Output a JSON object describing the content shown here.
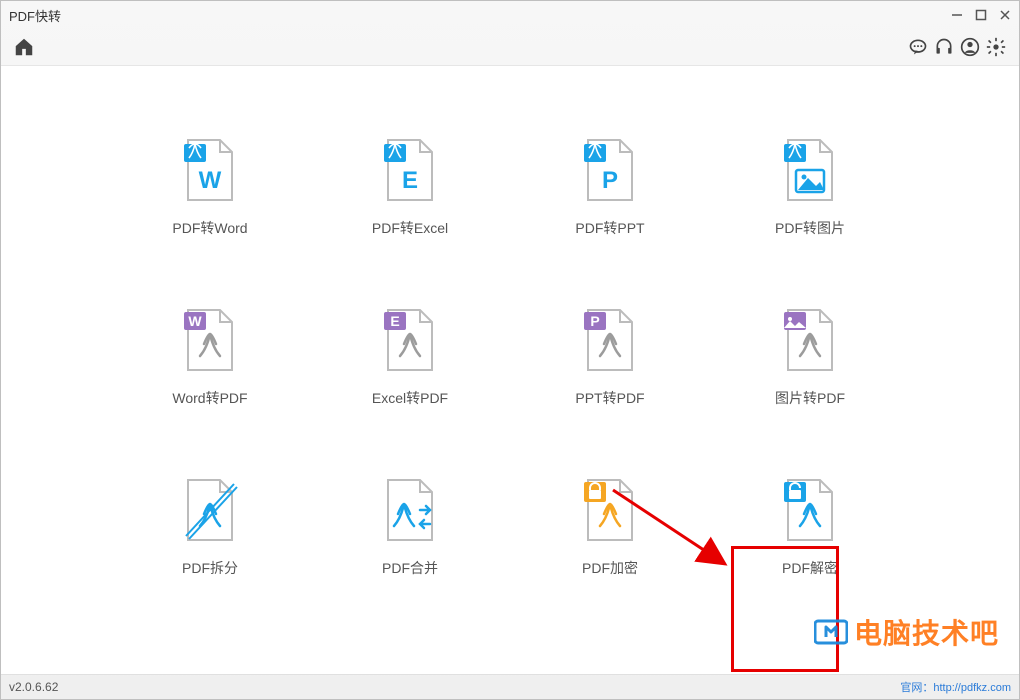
{
  "window": {
    "title": "PDF快转"
  },
  "status": {
    "version": "v2.0.6.62",
    "site_label": "官网：http://pdfkz.com"
  },
  "watermark": {
    "text": "电脑技术吧"
  },
  "colors": {
    "blue": "#1aa3e8",
    "purple": "#9a74c1",
    "orange": "#f5a623",
    "gray": "#9c9c9c",
    "red": "#e60000"
  },
  "tiles": [
    {
      "id": "pdf-to-word",
      "label": "PDF转Word"
    },
    {
      "id": "pdf-to-excel",
      "label": "PDF转Excel"
    },
    {
      "id": "pdf-to-ppt",
      "label": "PDF转PPT"
    },
    {
      "id": "pdf-to-image",
      "label": "PDF转图片"
    },
    {
      "id": "word-to-pdf",
      "label": "Word转PDF"
    },
    {
      "id": "excel-to-pdf",
      "label": "Excel转PDF"
    },
    {
      "id": "ppt-to-pdf",
      "label": "PPT转PDF"
    },
    {
      "id": "image-to-pdf",
      "label": "图片转PDF"
    },
    {
      "id": "pdf-split",
      "label": "PDF拆分"
    },
    {
      "id": "pdf-merge",
      "label": "PDF合并"
    },
    {
      "id": "pdf-encrypt",
      "label": "PDF加密"
    },
    {
      "id": "pdf-decrypt",
      "label": "PDF解密"
    }
  ]
}
